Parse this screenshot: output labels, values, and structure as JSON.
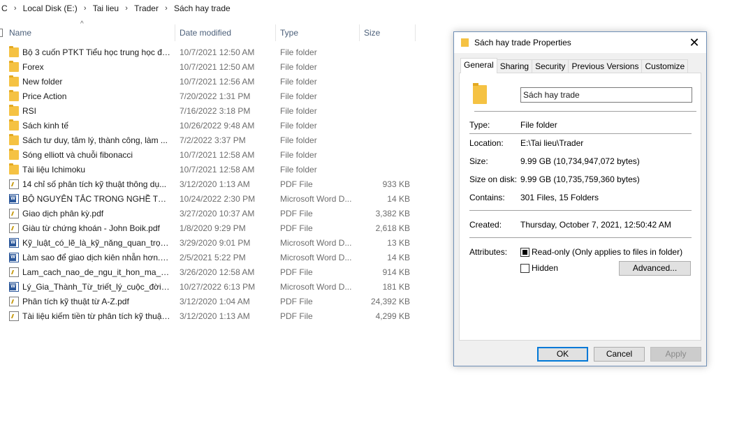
{
  "breadcrumb": [
    "C",
    "Local Disk (E:)",
    "Tai lieu",
    "Trader",
    "Sách hay trade"
  ],
  "columns": {
    "name": "Name",
    "date": "Date modified",
    "type": "Type",
    "size": "Size"
  },
  "files": [
    {
      "icon": "folder-icon",
      "name": "Bộ 3 cuốn PTKT Tiểu học trung học đạ...",
      "date": "10/7/2021 12:50 AM",
      "type": "File folder",
      "size": ""
    },
    {
      "icon": "folder-icon",
      "name": "Forex",
      "date": "10/7/2021 12:50 AM",
      "type": "File folder",
      "size": ""
    },
    {
      "icon": "folder-icon",
      "name": "New folder",
      "date": "10/7/2021 12:56 AM",
      "type": "File folder",
      "size": ""
    },
    {
      "icon": "folder-icon",
      "name": "Price Action",
      "date": "7/20/2022 1:31 PM",
      "type": "File folder",
      "size": ""
    },
    {
      "icon": "folder-icon",
      "name": "RSI",
      "date": "7/16/2022 3:18 PM",
      "type": "File folder",
      "size": ""
    },
    {
      "icon": "folder-icon",
      "name": "Sách kinh tế",
      "date": "10/26/2022 9:48 AM",
      "type": "File folder",
      "size": ""
    },
    {
      "icon": "folder-icon",
      "name": "Sách tư duy, tâm lý, thành công, làm ...",
      "date": "7/2/2022 3:37 PM",
      "type": "File folder",
      "size": ""
    },
    {
      "icon": "folder-icon",
      "name": "Sóng elliott và chuỗi fibonacci",
      "date": "10/7/2021 12:58 AM",
      "type": "File folder",
      "size": ""
    },
    {
      "icon": "folder-icon",
      "name": "Tài liệu Ichimoku",
      "date": "10/7/2021 12:58 AM",
      "type": "File folder",
      "size": ""
    },
    {
      "icon": "pdf-icon",
      "name": "14 chỉ số phân tích kỹ thuật thông dụ...",
      "date": "3/12/2020 1:13 AM",
      "type": "PDF File",
      "size": "933 KB"
    },
    {
      "icon": "word-doc-icon",
      "name": "BỘ NGUYÊN TẮC TRONG NGHỀ TRAD...",
      "date": "10/24/2022 2:30 PM",
      "type": "Microsoft Word D...",
      "size": "14 KB"
    },
    {
      "icon": "pdf-icon",
      "name": "Giao dịch phân kỳ.pdf",
      "date": "3/27/2020 10:37 AM",
      "type": "PDF File",
      "size": "3,382 KB"
    },
    {
      "icon": "pdf-icon",
      "name": "Giàu từ chứng khoán - John Boik.pdf",
      "date": "1/8/2020 9:29 PM",
      "type": "PDF File",
      "size": "2,618 KB"
    },
    {
      "icon": "word-doc-icon",
      "name": "Kỹ_luật_có_lẽ_là_kỹ_năng_quan_trọng....",
      "date": "3/29/2020 9:01 PM",
      "type": "Microsoft Word D...",
      "size": "13 KB"
    },
    {
      "icon": "word-doc-icon",
      "name": "Làm sao để giao dịch kiên nhẫn hơn.d...",
      "date": "2/5/2021 5:22 PM",
      "type": "Microsoft Word D...",
      "size": "14 KB"
    },
    {
      "icon": "pdf-icon",
      "name": "Lam_cach_nao_de_ngu_it_hon_ma_va...",
      "date": "3/26/2020 12:58 AM",
      "type": "PDF File",
      "size": "914 KB"
    },
    {
      "icon": "word-doc-icon",
      "name": "Lý_Gia_Thành_Từ_triết_lý_cuộc_đời_đế...",
      "date": "10/27/2022 6:13 PM",
      "type": "Microsoft Word D...",
      "size": "181 KB"
    },
    {
      "icon": "pdf-icon",
      "name": "Phân tích kỹ thuật từ A-Z.pdf",
      "date": "3/12/2020 1:04 AM",
      "type": "PDF File",
      "size": "24,392 KB"
    },
    {
      "icon": "pdf-icon",
      "name": "Tài liệu kiếm tiền từ phân tích kỹ thuật...",
      "date": "3/12/2020 1:13 AM",
      "type": "PDF File",
      "size": "4,299 KB"
    }
  ],
  "dialog": {
    "title": "Sách hay trade Properties",
    "close": "✕",
    "tabs": [
      "General",
      "Sharing",
      "Security",
      "Previous Versions",
      "Customize"
    ],
    "folder_name": "Sách hay trade",
    "type_label": "Type:",
    "type_value": "File folder",
    "location_label": "Location:",
    "location_value": "E:\\Tai lieu\\Trader",
    "size_label": "Size:",
    "size_value": "9.99 GB (10,734,947,072 bytes)",
    "size_on_disk_label": "Size on disk:",
    "size_on_disk_value": "9.99 GB (10,735,759,360 bytes)",
    "contains_label": "Contains:",
    "contains_value": "301 Files, 15 Folders",
    "created_label": "Created:",
    "created_value": "Thursday, October 7, 2021, 12:50:42 AM",
    "attributes_label": "Attributes:",
    "readonly_label": "Read-only (Only applies to files in folder)",
    "hidden_label": "Hidden",
    "advanced_label": "Advanced...",
    "ok_label": "OK",
    "cancel_label": "Cancel",
    "apply_label": "Apply"
  }
}
